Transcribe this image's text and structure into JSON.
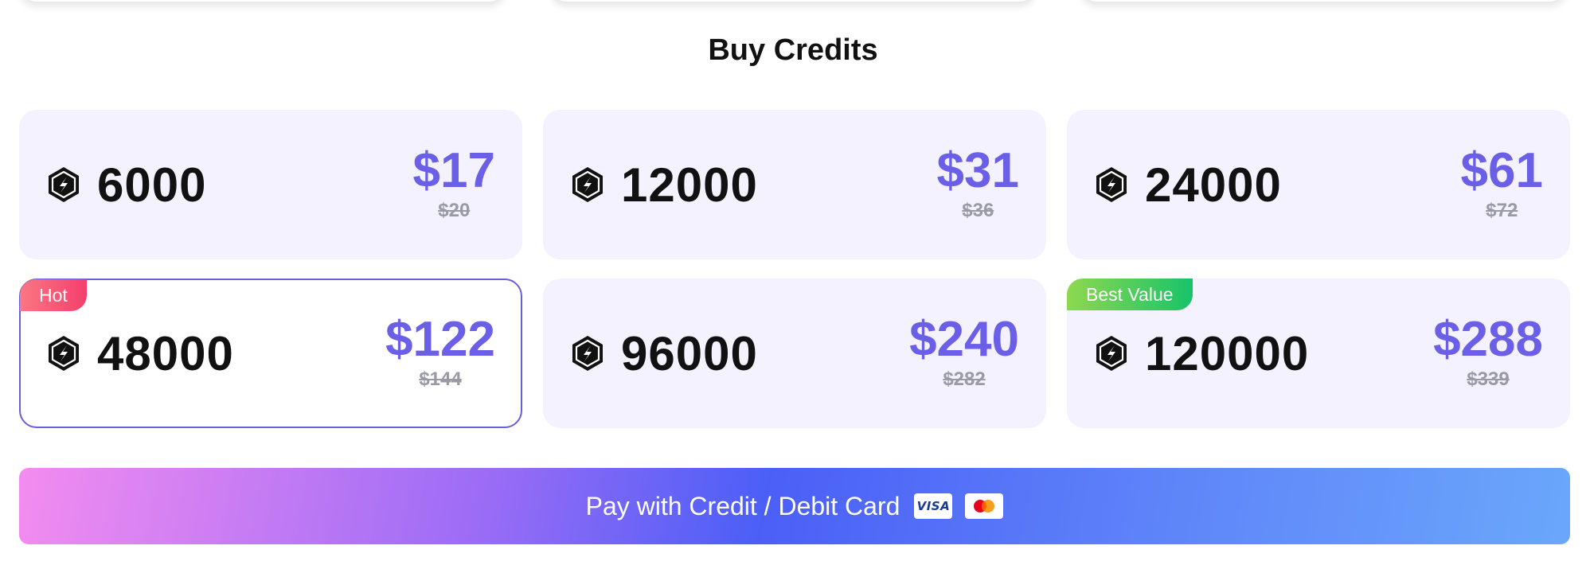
{
  "section": {
    "title": "Buy Credits"
  },
  "packages": [
    {
      "amount": "6000",
      "price": "$17",
      "original_price": "$20",
      "badge": "",
      "selected": false
    },
    {
      "amount": "12000",
      "price": "$31",
      "original_price": "$36",
      "badge": "",
      "selected": false
    },
    {
      "amount": "24000",
      "price": "$61",
      "original_price": "$72",
      "badge": "",
      "selected": false
    },
    {
      "amount": "48000",
      "price": "$122",
      "original_price": "$144",
      "badge": "Hot",
      "selected": true
    },
    {
      "amount": "96000",
      "price": "$240",
      "original_price": "$282",
      "badge": "",
      "selected": false
    },
    {
      "amount": "120000",
      "price": "$288",
      "original_price": "$339",
      "badge": "Best Value",
      "selected": false
    }
  ],
  "payment": {
    "button_label": "Pay with Credit / Debit Card",
    "visa_label": "VISA",
    "card_icons": [
      "visa-icon",
      "mastercard-icon"
    ]
  },
  "icons": {
    "credit": "credit-coin-icon"
  },
  "colors": {
    "accent": "#6a5fe6",
    "card_bg": "#f3f2fe",
    "selected_border": "#6a5fd6",
    "hot_badge": "#f43f6c",
    "best_badge": "#18c36a",
    "strike_text": "#9a9aa6"
  }
}
